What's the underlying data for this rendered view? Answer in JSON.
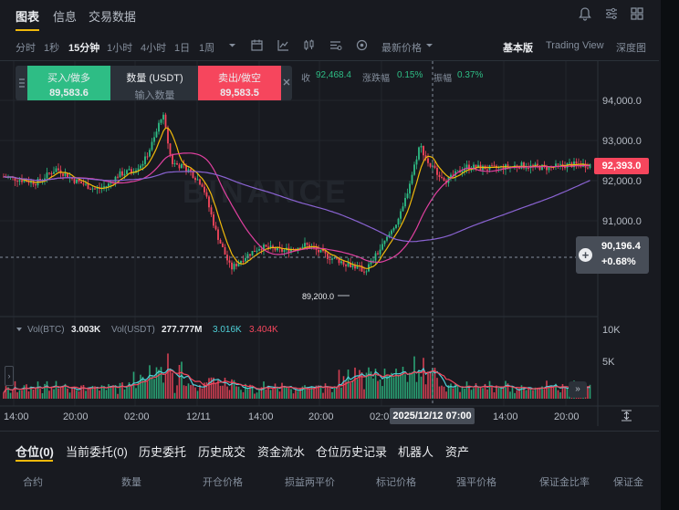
{
  "tabs": {
    "chart": "图表",
    "info": "信息",
    "trade_data": "交易数据"
  },
  "toolbar": {
    "time": "分时",
    "s1": "1秒",
    "m15": "15分钟",
    "h1": "1小时",
    "h4": "4小时",
    "d1": "1日",
    "w1": "1周",
    "latest_price": "最新价格",
    "basic": "基本版",
    "tradingview": "Trading View",
    "depth": "深度图"
  },
  "order_panel": {
    "buy_label": "买入/做多",
    "buy_price": "89,583.6",
    "qty_label": "数量 (USDT)",
    "qty_placeholder": "输入数量",
    "sell_label": "卖出/做空",
    "sell_price": "89,583.5"
  },
  "stats": {
    "close_label": "收",
    "close_value": "92,468.4",
    "change_label": "涨跌幅",
    "change_value": "0.15%",
    "amp_label": "振幅",
    "amp_value": "0.37%"
  },
  "price_axis": [
    "94,000.0",
    "93,000.0",
    "92,000.0",
    "91,000.0"
  ],
  "current_price": "92,393.0",
  "crosshair": {
    "price": "90,196.4",
    "pct": "+0.68%",
    "time": "2025/12/12 07:00"
  },
  "low_marker": "89,200.0",
  "watermark": "BINANCE",
  "volume": {
    "label1": "Vol(BTC)",
    "value1": "3.003K",
    "label2": "Vol(USDT)",
    "value2": "277.777M",
    "ma1": "3.016K",
    "ma2": "3.404K",
    "axis": [
      "10K",
      "5K"
    ]
  },
  "time_axis": [
    "14:00",
    "20:00",
    "02:00",
    "12/11",
    "14:00",
    "20:00",
    "02:0",
    "14:00",
    "20:00"
  ],
  "bottom_tabs": [
    "仓位(0)",
    "当前委托(0)",
    "历史委托",
    "历史成交",
    "资金流水",
    "仓位历史记录",
    "机器人",
    "资产"
  ],
  "columns": [
    "合约",
    "数量",
    "开仓价格",
    "损益两平价",
    "标记价格",
    "强平价格",
    "保证金比率",
    "保证金"
  ],
  "colors": {
    "up": "#2ebd85",
    "down": "#f6465d",
    "ma1": "#f0b90b",
    "ma2": "#e040a0",
    "ma3": "#8a63d2",
    "bg": "#181a20"
  },
  "chart_data": {
    "type": "candlestick",
    "interval": "15m",
    "price_range": [
      89000,
      94500
    ],
    "current_price": 92393.0,
    "labeled_low": 89200.0,
    "crosshair_price": 90196.4,
    "volume_axis": [
      "10K",
      "5K"
    ]
  }
}
